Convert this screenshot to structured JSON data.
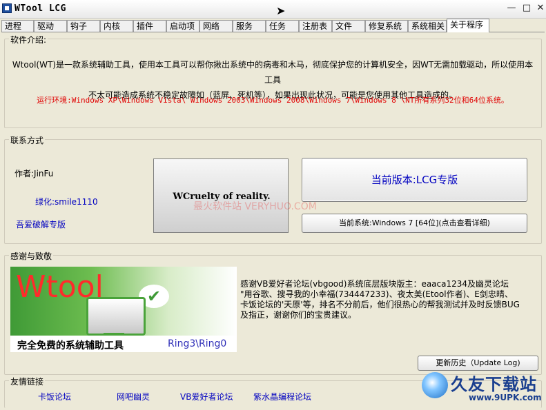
{
  "window": {
    "title": "WTool LCG"
  },
  "tabs": [
    {
      "label": "进程"
    },
    {
      "label": "驱动"
    },
    {
      "label": "钩子"
    },
    {
      "label": "内核"
    },
    {
      "label": "插件"
    },
    {
      "label": "启动项"
    },
    {
      "label": "网络"
    },
    {
      "label": "服务"
    },
    {
      "label": "任务"
    },
    {
      "label": "注册表"
    },
    {
      "label": "文件"
    },
    {
      "label": "修复系统"
    },
    {
      "label": "系统相关"
    },
    {
      "label": "关于程序"
    }
  ],
  "active_tab": "关于程序",
  "intro": {
    "title": "软件介绍:",
    "line1": "Wtool(WT)是一款系统辅助工具，使用本工具可以帮你揪出系统中的病毒和木马，彻底保护您的计算机安全，因WT无需加载驱动，所以使用本工具",
    "line2": "不太可能造成系统不稳定故障如（蓝屏、死机等），如果出现此状况，可能是您使用其他工具造成的。",
    "env": "运行环境:Windows XP\\Windows Vista\\ Windows 2003\\Windows 2008\\Windows 7\\Windows 8 \\NT所有系列32位和64位系统。"
  },
  "contact": {
    "title": "联系方式",
    "author": "作者:JinFu",
    "greening": "绿化:smile1110",
    "crack": "吾爱破解专版",
    "motto": "WCruelty of reality.",
    "version_button": "当前版本:LCG专版",
    "system_button": "当前系统:Windows 7 [64位](点击查看详细)"
  },
  "watermark": "最火软件站 VERYHUO.COM",
  "thanks": {
    "title": "感谢与致敬",
    "banner_logo": "Wtool",
    "banner_slogan": "完全免费的系统辅助工具",
    "banner_ring": "Ring3\\Ring0",
    "text": "感谢VB爱好者论坛(vbgood)系统底层版块版主：eaaca1234及幽灵论坛 \"用谷歌、搜寻我的小幸福(734447233)、夜太美(Etool作者)、E剑忠晴、卡饭论坛的'天原'等，排名不分前后，他们很热心的帮我测试并及时反馈BUG及指正，谢谢你们的宝贵建议。",
    "update_button": "更新历史（Update Log)"
  },
  "friend_links": {
    "title": "友情链接",
    "items": [
      {
        "label": "卡饭论坛"
      },
      {
        "label": "网吧幽灵"
      },
      {
        "label": "VB爱好者论坛"
      },
      {
        "label": "紫水晶编程论坛"
      }
    ]
  },
  "site_logo": {
    "name": "久友下载站",
    "url": "www.9UPK.com"
  },
  "colors": {
    "link": "#0000c0",
    "env_text": "#e00000",
    "background": "#ece9d8"
  },
  "icons": {
    "app": "wtool-app-icon",
    "cursor": "mouse-cursor-icon"
  }
}
